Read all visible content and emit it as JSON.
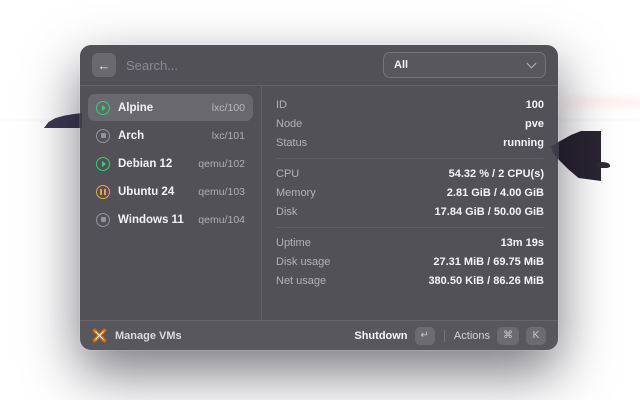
{
  "window": {
    "search": {
      "placeholder": "Search..."
    },
    "filter_dropdown": {
      "value": "All"
    },
    "vm_list": [
      {
        "name": "Alpine",
        "meta": "lxc/100",
        "status": "running",
        "selected": true
      },
      {
        "name": "Arch",
        "meta": "lxc/101",
        "status": "stopped",
        "selected": false
      },
      {
        "name": "Debian 12",
        "meta": "qemu/102",
        "status": "running",
        "selected": false
      },
      {
        "name": "Ubuntu 24",
        "meta": "qemu/103",
        "status": "paused",
        "selected": false
      },
      {
        "name": "Windows 11",
        "meta": "qemu/104",
        "status": "stopped",
        "selected": false
      }
    ],
    "details": {
      "sections": [
        {
          "rows": [
            {
              "label": "ID",
              "value": "100"
            },
            {
              "label": "Node",
              "value": "pve"
            },
            {
              "label": "Status",
              "value": "running"
            }
          ]
        },
        {
          "rows": [
            {
              "label": "CPU",
              "value": "54.32 % / 2 CPU(s)"
            },
            {
              "label": "Memory",
              "value": "2.81 GiB / 4.00 GiB"
            },
            {
              "label": "Disk",
              "value": "17.84 GiB / 50.00 GiB"
            }
          ]
        },
        {
          "rows": [
            {
              "label": "Uptime",
              "value": "13m 19s"
            },
            {
              "label": "Disk usage",
              "value": "27.31 MiB / 69.75 MiB"
            },
            {
              "label": "Net usage",
              "value": "380.50 KiB / 86.26 MiB"
            }
          ]
        }
      ]
    },
    "footer": {
      "app_icon": "proxmox-logo",
      "app_label": "Manage VMs",
      "primary_action": {
        "label": "Shutdown",
        "key": "↵"
      },
      "secondary_action": {
        "label": "Actions",
        "keys": [
          "⌘",
          "K"
        ]
      }
    }
  },
  "icons": {
    "back": "←"
  },
  "colors": {
    "status_running": "#35d16e",
    "status_stopped": "#93939b",
    "status_paused": "#eda53e",
    "proxmox_orange": "#e57000"
  }
}
